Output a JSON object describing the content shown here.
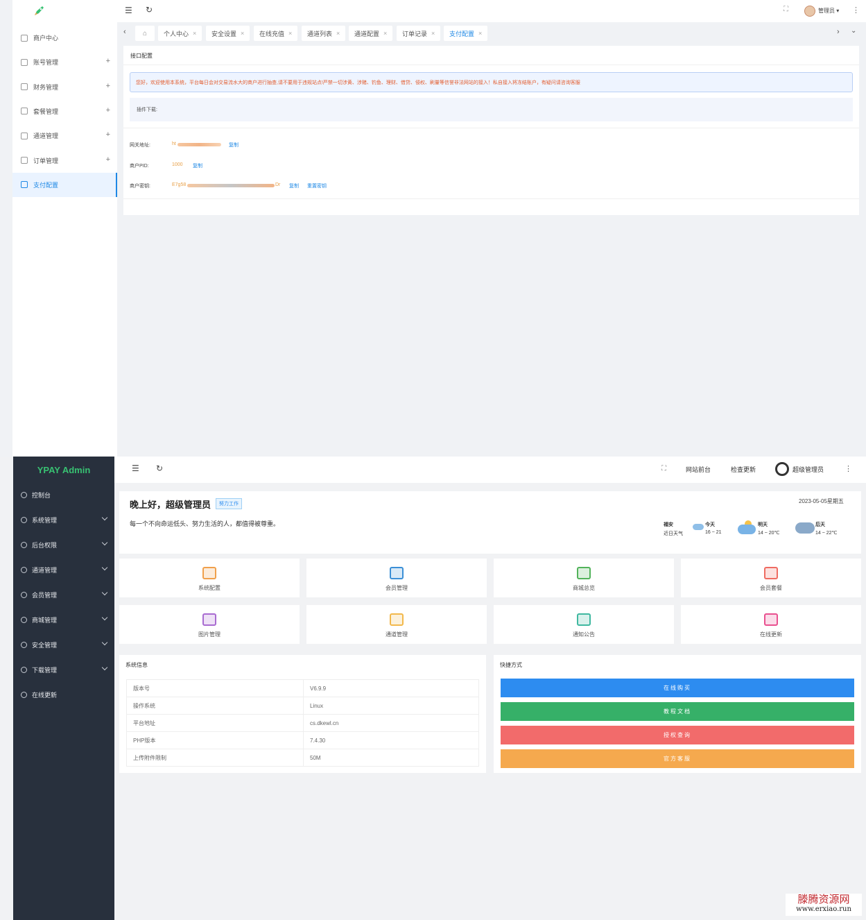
{
  "shot_a": {
    "sidebar": {
      "items": [
        {
          "label": "商户中心",
          "has_plus": false,
          "active": false
        },
        {
          "label": "账号管理",
          "has_plus": true,
          "active": false
        },
        {
          "label": "财务管理",
          "has_plus": true,
          "active": false
        },
        {
          "label": "套餐管理",
          "has_plus": true,
          "active": false
        },
        {
          "label": "通道管理",
          "has_plus": true,
          "active": false
        },
        {
          "label": "订单管理",
          "has_plus": true,
          "active": false
        },
        {
          "label": "支付配置",
          "has_plus": false,
          "active": true
        }
      ],
      "plus_glyph": "+"
    },
    "header": {
      "user_label": "管理员 ▾",
      "more": "⋮"
    },
    "tabs": [
      {
        "label": "个人中心"
      },
      {
        "label": "安全设置"
      },
      {
        "label": "在线充值"
      },
      {
        "label": "通道列表"
      },
      {
        "label": "通道配置"
      },
      {
        "label": "订单记录"
      },
      {
        "label": "支付配置",
        "active": true
      }
    ],
    "tab_close": "×",
    "card": {
      "title": "接口配置",
      "notice": "您好，欢迎使用本系统，平台每日会对交易流水大的商户进行抽查,请不要用于违规站点!严禁一切涉黄、涉赌、钓鱼、理财、借贷、侵权、刷量等信誉非法网站的接入！私自接入将冻结账户，有疑问请咨询客服",
      "plugin_label": "插件下载:",
      "gateway_label": "网关地址:",
      "gateway_value": "ht",
      "gateway_copy": "复制",
      "pid_label": "商户PID:",
      "pid_value": "1000",
      "pid_copy": "复制",
      "key_label": "商户密钥:",
      "key_value_start": "E7g58",
      "key_value_end": "Dr",
      "key_copy": "复制",
      "key_reset": "重置密钥"
    }
  },
  "shot_b": {
    "brand": "YPAY Admin",
    "sidebar": {
      "items": [
        {
          "label": "控制台",
          "has_chevron": false
        },
        {
          "label": "系统管理",
          "has_chevron": true
        },
        {
          "label": "后台权限",
          "has_chevron": true
        },
        {
          "label": "通道管理",
          "has_chevron": true
        },
        {
          "label": "会员管理",
          "has_chevron": true
        },
        {
          "label": "商城管理",
          "has_chevron": true
        },
        {
          "label": "安全管理",
          "has_chevron": true
        },
        {
          "label": "下载管理",
          "has_chevron": true
        },
        {
          "label": "在线更新",
          "has_chevron": false
        }
      ]
    },
    "header": {
      "frontend": "网站前台",
      "check_update": "检查更新",
      "user": "超级管理员",
      "more": "⋮"
    },
    "welcome": {
      "greeting": "晚上好，超级管理员",
      "tag": "努力工作",
      "motto": "每一个不向命运低头、努力生活的人，都值得被尊重。",
      "date": "2023-05-05星期五",
      "city": "福安",
      "recent": "近日天气",
      "weather": [
        {
          "day": "今天",
          "range": "16 ~ 21"
        },
        {
          "day": "明天",
          "range": "14 ~ 20℃"
        },
        {
          "day": "后天",
          "range": "14 ~ 22℃"
        }
      ]
    },
    "tiles": [
      {
        "label": "系统配置",
        "icon": "sliders-icon",
        "color": "#f0a04b"
      },
      {
        "label": "会员管理",
        "icon": "users-icon",
        "color": "#3b8fd6"
      },
      {
        "label": "商城总览",
        "icon": "shop-icon",
        "color": "#52b35a"
      },
      {
        "label": "会员套餐",
        "icon": "cart-icon",
        "color": "#ef6b61"
      },
      {
        "label": "图片管理",
        "icon": "image-icon",
        "color": "#a86bd1"
      },
      {
        "label": "通道管理",
        "icon": "card-icon",
        "color": "#f2b84b"
      },
      {
        "label": "通知公告",
        "icon": "mail-icon",
        "color": "#3fb8a0"
      },
      {
        "label": "在线更新",
        "icon": "shield-icon",
        "color": "#e9508f"
      }
    ],
    "sysinfo": {
      "title": "系统信息",
      "rows": [
        {
          "k": "版本号",
          "v": "V6.9.9"
        },
        {
          "k": "操作系统",
          "v": "Linux"
        },
        {
          "k": "平台地址",
          "v": "cs.dkewl.cn"
        },
        {
          "k": "PHP版本",
          "v": "7.4.30"
        },
        {
          "k": "上传附件限制",
          "v": "50M"
        }
      ]
    },
    "quick": {
      "title": "快捷方式",
      "buttons": [
        {
          "label": "在线购买",
          "color": "#2d8cf0"
        },
        {
          "label": "教程文档",
          "color": "#36b068"
        },
        {
          "label": "授权查询",
          "color": "#f26b6b"
        },
        {
          "label": "官方客服",
          "color": "#f5a94e"
        }
      ]
    },
    "watermark": {
      "cn": "滕腾资源网",
      "url": "www.erxiao.run"
    }
  }
}
